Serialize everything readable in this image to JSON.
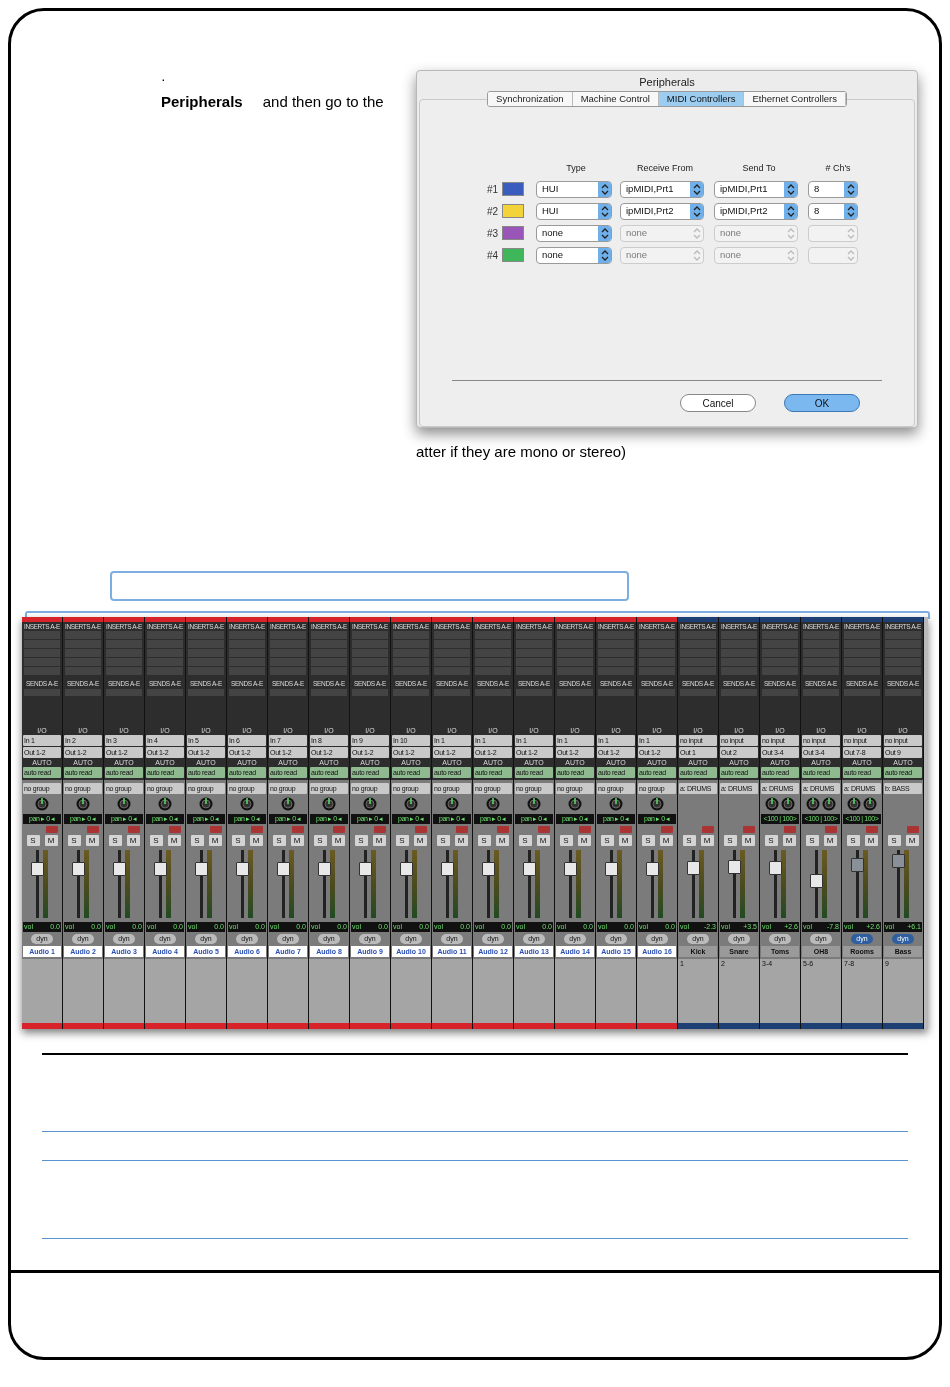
{
  "text_fragments": {
    "bullet": "·",
    "intro_bold": "Peripherals",
    "intro_rest": "and then go to the",
    "note": "atter if they are mono or stereo)"
  },
  "dialog": {
    "title": "Peripherals",
    "tabs": [
      {
        "label": "Synchronization",
        "selected": false
      },
      {
        "label": "Machine Control",
        "selected": false
      },
      {
        "label": "MIDI Controllers",
        "selected": true
      },
      {
        "label": "Ethernet Controllers",
        "selected": false
      }
    ],
    "columns": [
      "Type",
      "Receive From",
      "Send To",
      "# Ch's"
    ],
    "rows": [
      {
        "label": "#1",
        "color": "#3a5cbf",
        "type": "HUI",
        "receive": "ipMIDI,Prt1",
        "send": "ipMIDI,Prt1",
        "channels": "8",
        "disabled": false
      },
      {
        "label": "#2",
        "color": "#f2d43a",
        "type": "HUI",
        "receive": "ipMIDI,Prt2",
        "send": "ipMIDI,Prt2",
        "channels": "8",
        "disabled": false
      },
      {
        "label": "#3",
        "color": "#9a55b8",
        "type": "none",
        "receive": "none",
        "send": "none",
        "disabled": true
      },
      {
        "label": "#4",
        "color": "#3fb65a",
        "type": "none",
        "receive": "none",
        "send": "none",
        "disabled": true
      }
    ],
    "buttons": [
      {
        "label": "Cancel",
        "default": false
      },
      {
        "label": "OK",
        "default": true
      }
    ]
  },
  "mixer": {
    "strips": [
      {
        "inserts": "INSERTS A-E",
        "sends": "SENDS A-E",
        "io": "I/O",
        "input": "In 1",
        "output": "Out 1-2",
        "auto": "AUTO",
        "auto_mode": "auto read",
        "group": "no group",
        "kind": "mono",
        "pan": "pan ▸ 0 ◂",
        "solo": "S",
        "mute": "M",
        "level": 0.78,
        "vol_label": "vol",
        "vol": "0.0",
        "dyn": "dyn",
        "name": "Audio 1",
        "color": "#d8232a",
        "inactive": false
      },
      {
        "inserts": "INSERTS A-E",
        "sends": "SENDS A-E",
        "io": "I/O",
        "input": "In 2",
        "output": "Out 1-2",
        "auto": "AUTO",
        "auto_mode": "auto read",
        "group": "no group",
        "kind": "mono",
        "pan": "pan ▸ 0 ◂",
        "solo": "S",
        "mute": "M",
        "level": 0.78,
        "vol_label": "vol",
        "vol": "0.0",
        "dyn": "dyn",
        "name": "Audio 2",
        "color": "#d8232a",
        "inactive": false
      },
      {
        "inserts": "INSERTS A-E",
        "sends": "SENDS A-E",
        "io": "I/O",
        "input": "In 3",
        "output": "Out 1-2",
        "auto": "AUTO",
        "auto_mode": "auto read",
        "group": "no group",
        "kind": "mono",
        "pan": "pan ▸ 0 ◂",
        "solo": "S",
        "mute": "M",
        "level": 0.78,
        "vol_label": "vol",
        "vol": "0.0",
        "dyn": "dyn",
        "name": "Audio 3",
        "color": "#d8232a",
        "inactive": false
      },
      {
        "inserts": "INSERTS A-E",
        "sends": "SENDS A-E",
        "io": "I/O",
        "input": "In 4",
        "output": "Out 1-2",
        "auto": "AUTO",
        "auto_mode": "auto read",
        "group": "no group",
        "kind": "mono",
        "pan": "pan ▸ 0 ◂",
        "solo": "S",
        "mute": "M",
        "level": 0.78,
        "vol_label": "vol",
        "vol": "0.0",
        "dyn": "dyn",
        "name": "Audio 4",
        "color": "#d8232a",
        "inactive": false
      },
      {
        "inserts": "INSERTS A-E",
        "sends": "SENDS A-E",
        "io": "I/O",
        "input": "In 5",
        "output": "Out 1-2",
        "auto": "AUTO",
        "auto_mode": "auto read",
        "group": "no group",
        "kind": "mono",
        "pan": "pan ▸ 0 ◂",
        "solo": "S",
        "mute": "M",
        "level": 0.78,
        "vol_label": "vol",
        "vol": "0.0",
        "dyn": "dyn",
        "name": "Audio 5",
        "color": "#d8232a",
        "inactive": false
      },
      {
        "inserts": "INSERTS A-E",
        "sends": "SENDS A-E",
        "io": "I/O",
        "input": "In 6",
        "output": "Out 1-2",
        "auto": "AUTO",
        "auto_mode": "auto read",
        "group": "no group",
        "kind": "mono",
        "pan": "pan ▸ 0 ◂",
        "solo": "S",
        "mute": "M",
        "level": 0.78,
        "vol_label": "vol",
        "vol": "0.0",
        "dyn": "dyn",
        "name": "Audio 6",
        "color": "#d8232a",
        "inactive": false
      },
      {
        "inserts": "INSERTS A-E",
        "sends": "SENDS A-E",
        "io": "I/O",
        "input": "In 7",
        "output": "Out 1-2",
        "auto": "AUTO",
        "auto_mode": "auto read",
        "group": "no group",
        "kind": "mono",
        "pan": "pan ▸ 0 ◂",
        "solo": "S",
        "mute": "M",
        "level": 0.78,
        "vol_label": "vol",
        "vol": "0.0",
        "dyn": "dyn",
        "name": "Audio 7",
        "color": "#d8232a",
        "inactive": false
      },
      {
        "inserts": "INSERTS A-E",
        "sends": "SENDS A-E",
        "io": "I/O",
        "input": "In 8",
        "output": "Out 1-2",
        "auto": "AUTO",
        "auto_mode": "auto read",
        "group": "no group",
        "kind": "mono",
        "pan": "pan ▸ 0 ◂",
        "solo": "S",
        "mute": "M",
        "level": 0.78,
        "vol_label": "vol",
        "vol": "0.0",
        "dyn": "dyn",
        "name": "Audio 8",
        "color": "#d8232a",
        "inactive": false
      },
      {
        "inserts": "INSERTS A-E",
        "sends": "SENDS A-E",
        "io": "I/O",
        "input": "In 9",
        "output": "Out 1-2",
        "auto": "AUTO",
        "auto_mode": "auto read",
        "group": "no group",
        "kind": "mono",
        "pan": "pan ▸ 0 ◂",
        "solo": "S",
        "mute": "M",
        "level": 0.78,
        "vol_label": "vol",
        "vol": "0.0",
        "dyn": "dyn",
        "name": "Audio 9",
        "color": "#d8232a",
        "inactive": false
      },
      {
        "inserts": "INSERTS A-E",
        "sends": "SENDS A-E",
        "io": "I/O",
        "input": "In 10",
        "output": "Out 1-2",
        "auto": "AUTO",
        "auto_mode": "auto read",
        "group": "no group",
        "kind": "mono",
        "pan": "pan ▸ 0 ◂",
        "solo": "S",
        "mute": "M",
        "level": 0.78,
        "vol_label": "vol",
        "vol": "0.0",
        "dyn": "dyn",
        "name": "Audio 10",
        "color": "#d8232a",
        "inactive": false
      },
      {
        "inserts": "INSERTS A-E",
        "sends": "SENDS A-E",
        "io": "I/O",
        "input": "In 1",
        "output": "Out 1-2",
        "auto": "AUTO",
        "auto_mode": "auto read",
        "group": "no group",
        "kind": "mono",
        "pan": "pan ▸ 0 ◂",
        "solo": "S",
        "mute": "M",
        "level": 0.78,
        "vol_label": "vol",
        "vol": "0.0",
        "dyn": "dyn",
        "name": "Audio 11",
        "color": "#d8232a",
        "inactive": false
      },
      {
        "inserts": "INSERTS A-E",
        "sends": "SENDS A-E",
        "io": "I/O",
        "input": "In 1",
        "output": "Out 1-2",
        "auto": "AUTO",
        "auto_mode": "auto read",
        "group": "no group",
        "kind": "mono",
        "pan": "pan ▸ 0 ◂",
        "solo": "S",
        "mute": "M",
        "level": 0.78,
        "vol_label": "vol",
        "vol": "0.0",
        "dyn": "dyn",
        "name": "Audio 12",
        "color": "#d8232a",
        "inactive": false
      },
      {
        "inserts": "INSERTS A-E",
        "sends": "SENDS A-E",
        "io": "I/O",
        "input": "In 1",
        "output": "Out 1-2",
        "auto": "AUTO",
        "auto_mode": "auto read",
        "group": "no group",
        "kind": "mono",
        "pan": "pan ▸ 0 ◂",
        "solo": "S",
        "mute": "M",
        "level": 0.78,
        "vol_label": "vol",
        "vol": "0.0",
        "dyn": "dyn",
        "name": "Audio 13",
        "color": "#d8232a",
        "inactive": false
      },
      {
        "inserts": "INSERTS A-E",
        "sends": "SENDS A-E",
        "io": "I/O",
        "input": "In 1",
        "output": "Out 1-2",
        "auto": "AUTO",
        "auto_mode": "auto read",
        "group": "no group",
        "kind": "mono",
        "pan": "pan ▸ 0 ◂",
        "solo": "S",
        "mute": "M",
        "level": 0.78,
        "vol_label": "vol",
        "vol": "0.0",
        "dyn": "dyn",
        "name": "Audio 14",
        "color": "#d8232a",
        "inactive": false
      },
      {
        "inserts": "INSERTS A-E",
        "sends": "SENDS A-E",
        "io": "I/O",
        "input": "In 1",
        "output": "Out 1-2",
        "auto": "AUTO",
        "auto_mode": "auto read",
        "group": "no group",
        "kind": "mono",
        "pan": "pan ▸ 0 ◂",
        "solo": "S",
        "mute": "M",
        "level": 0.78,
        "vol_label": "vol",
        "vol": "0.0",
        "dyn": "dyn",
        "name": "Audio 15",
        "color": "#d8232a",
        "inactive": false
      },
      {
        "inserts": "INSERTS A-E",
        "sends": "SENDS A-E",
        "io": "I/O",
        "input": "In 1",
        "output": "Out 1-2",
        "auto": "AUTO",
        "auto_mode": "auto read",
        "group": "no group",
        "kind": "mono",
        "pan": "pan ▸ 0 ◂",
        "solo": "S",
        "mute": "M",
        "level": 0.78,
        "vol_label": "vol",
        "vol": "0.0",
        "dyn": "dyn",
        "name": "Audio 16",
        "color": "#d8232a",
        "inactive": false
      },
      {
        "inserts": "INSERTS A-E",
        "sends": "SENDS A-E",
        "io": "I/O",
        "input": "no input",
        "output": "Out 1",
        "auto": "AUTO",
        "auto_mode": "auto read",
        "group": "a: DRUMS",
        "kind": "none",
        "solo": "S",
        "mute": "M",
        "level": 0.8,
        "vol_label": "vol",
        "vol": "-2.3",
        "dyn": "dyn",
        "name": "Kick",
        "comment": "1",
        "color": "#1d3f73",
        "inactive": false
      },
      {
        "inserts": "INSERTS A-E",
        "sends": "SENDS A-E",
        "io": "I/O",
        "input": "no input",
        "output": "Out 2",
        "auto": "AUTO",
        "auto_mode": "auto read",
        "group": "a: DRUMS",
        "kind": "none",
        "solo": "S",
        "mute": "M",
        "level": 0.82,
        "vol_label": "vol",
        "vol": "+3.5",
        "dyn": "dyn",
        "name": "Snare",
        "comment": "2",
        "color": "#1d3f73",
        "inactive": false
      },
      {
        "inserts": "INSERTS A-E",
        "sends": "SENDS A-E",
        "io": "I/O",
        "input": "no input",
        "output": "Out 3-4",
        "auto": "AUTO",
        "auto_mode": "auto read",
        "group": "a: DRUMS",
        "kind": "stereo",
        "pan": "<100 | 100>",
        "solo": "S",
        "mute": "M",
        "level": 0.8,
        "vol_label": "vol",
        "vol": "+2.6",
        "dyn": "dyn",
        "name": "Toms",
        "comment": "3-4",
        "color": "#1d3f73",
        "inactive": false
      },
      {
        "inserts": "INSERTS A-E",
        "sends": "SENDS A-E",
        "io": "I/O",
        "input": "no input",
        "output": "Out 3-4",
        "auto": "AUTO",
        "auto_mode": "auto read",
        "group": "a: DRUMS",
        "kind": "stereo",
        "pan": "<100 | 100>",
        "solo": "S",
        "mute": "M",
        "level": 0.55,
        "vol_label": "vol",
        "vol": "-7.8",
        "dyn": "dyn",
        "name": "OH8",
        "comment": "5-6",
        "color": "#1d3f73",
        "inactive": false
      },
      {
        "inserts": "INSERTS A-E",
        "sends": "SENDS A-E",
        "io": "I/O",
        "input": "no input",
        "output": "Out 7-8",
        "auto": "AUTO",
        "auto_mode": "auto read",
        "group": "a: DRUMS",
        "kind": "stereo",
        "pan": "<100 | 100>",
        "solo": "S",
        "mute": "M",
        "level": 0.85,
        "vol_label": "vol",
        "vol": "+2.6",
        "dyn": "dyn",
        "name": "Rooms",
        "comment": "7-8",
        "color": "#1d3f73",
        "inactive": true
      },
      {
        "inserts": "INSERTS A-E",
        "sends": "SENDS A-E",
        "io": "I/O",
        "input": "no input",
        "output": "Out 9",
        "auto": "AUTO",
        "auto_mode": "auto read",
        "group": "b: BASS",
        "kind": "none",
        "solo": "S",
        "mute": "M",
        "level": 0.92,
        "vol_label": "vol",
        "vol": "+6.1",
        "dyn": "dyn",
        "name": "Bass",
        "comment": "9",
        "color": "#1d3f73",
        "inactive": true
      }
    ]
  }
}
